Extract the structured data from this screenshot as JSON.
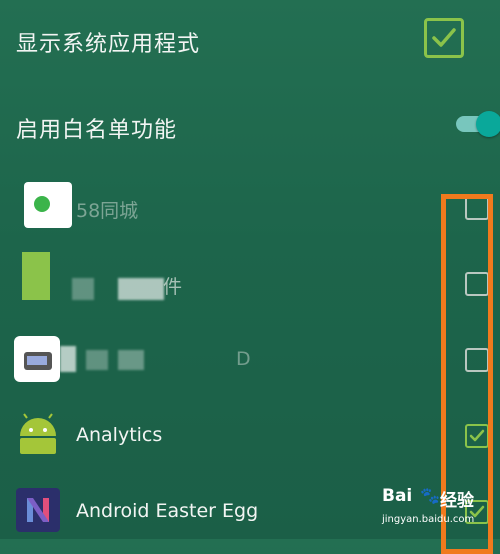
{
  "settings": {
    "show_system_apps": {
      "label": "显示系统应用程式",
      "checked": true
    },
    "whitelist": {
      "label": "启用白名单功能",
      "enabled": true
    }
  },
  "apps": [
    {
      "name": "58同城",
      "checked": false,
      "icon": "app-58-icon"
    },
    {
      "name": "件",
      "checked": false,
      "icon": "app-green-icon"
    },
    {
      "name": "D",
      "checked": false,
      "icon": "app-phone-icon"
    },
    {
      "name": "Analytics",
      "checked": true,
      "icon": "android-icon"
    },
    {
      "name": "Android Easter Egg",
      "checked": true,
      "icon": "android-n-icon"
    }
  ],
  "watermark": {
    "brand": "Bai",
    "brand2": "经验",
    "url": "jingyan.baidu.com"
  },
  "colors": {
    "background": "#1f6b4f",
    "check_accent": "#8bc34a",
    "toggle": "#0aa89a",
    "highlight_box": "#f07a1d"
  }
}
